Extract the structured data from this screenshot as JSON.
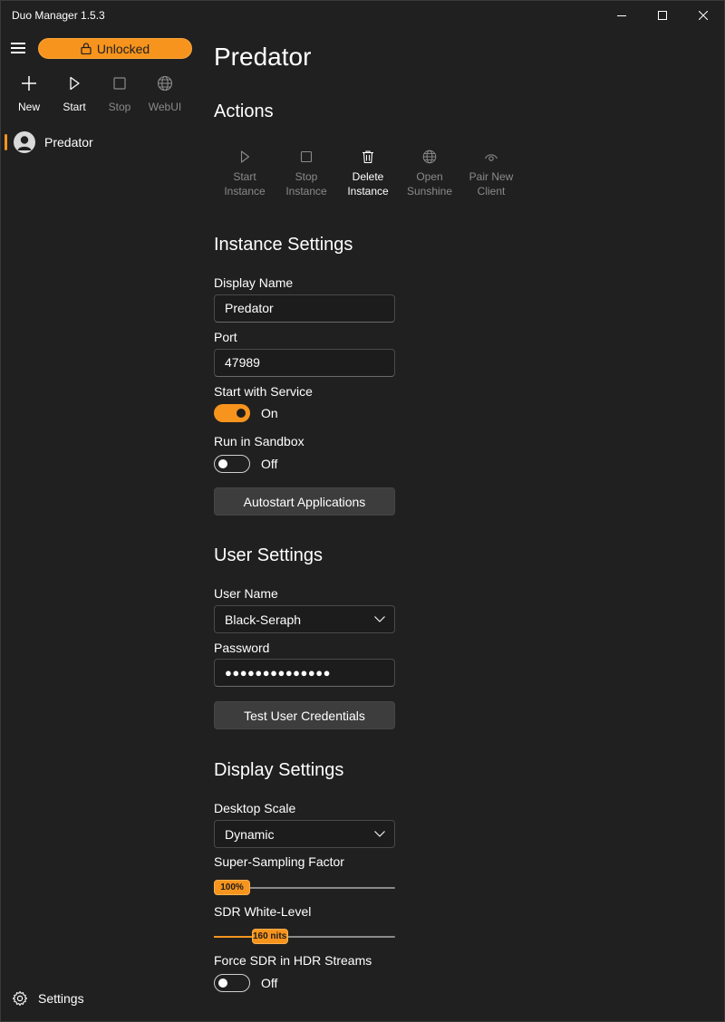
{
  "window": {
    "title": "Duo Manager 1.5.3",
    "controls": [
      "minimize",
      "maximize",
      "close"
    ]
  },
  "sidebar": {
    "unlock_label": "Unlocked",
    "toolbar": [
      {
        "label": "New",
        "icon": "plus-icon",
        "enabled": true
      },
      {
        "label": "Start",
        "icon": "play-icon",
        "enabled": true
      },
      {
        "label": "Stop",
        "icon": "stop-icon",
        "enabled": false
      },
      {
        "label": "WebUI",
        "icon": "globe-icon",
        "enabled": false
      }
    ],
    "instances": [
      {
        "label": "Predator",
        "selected": true
      }
    ],
    "settings_label": "Settings"
  },
  "main": {
    "title": "Predator",
    "actions_title": "Actions",
    "actions": [
      {
        "label": "Start\nInstance",
        "icon": "play-icon",
        "enabled": false
      },
      {
        "label": "Stop\nInstance",
        "icon": "stop-icon",
        "enabled": false
      },
      {
        "label": "Delete\nInstance",
        "icon": "trash-icon",
        "enabled": true
      },
      {
        "label": "Open\nSunshine",
        "icon": "globe-icon",
        "enabled": false
      },
      {
        "label": "Pair New\nClient",
        "icon": "eye-icon",
        "enabled": false
      }
    ],
    "instance_settings": {
      "title": "Instance Settings",
      "display_name_label": "Display Name",
      "display_name_value": "Predator",
      "port_label": "Port",
      "port_value": "47989",
      "start_with_service_label": "Start with Service",
      "start_with_service_state": "On",
      "run_in_sandbox_label": "Run in Sandbox",
      "run_in_sandbox_state": "Off",
      "autostart_button": "Autostart Applications"
    },
    "user_settings": {
      "title": "User Settings",
      "user_name_label": "User Name",
      "user_name_value": "Black-Seraph",
      "password_label": "Password",
      "password_value": "●●●●●●●●●●●●●●",
      "test_button": "Test User Credentials"
    },
    "display_settings": {
      "title": "Display Settings",
      "desktop_scale_label": "Desktop Scale",
      "desktop_scale_value": "Dynamic",
      "super_sampling_label": "Super-Sampling Factor",
      "super_sampling_value": "100%",
      "super_sampling_fraction": 0.0,
      "sdr_white_label": "SDR White-Level",
      "sdr_white_value": "160 nits",
      "sdr_white_fraction": 0.26,
      "force_sdr_label": "Force SDR in HDR Streams",
      "force_sdr_state": "Off"
    }
  },
  "colors": {
    "accent": "#f7941d",
    "background": "#202020",
    "input_bg": "#1c1c1c",
    "button_bg": "#3d3d3d",
    "disabled_text": "#8a8a8a"
  }
}
